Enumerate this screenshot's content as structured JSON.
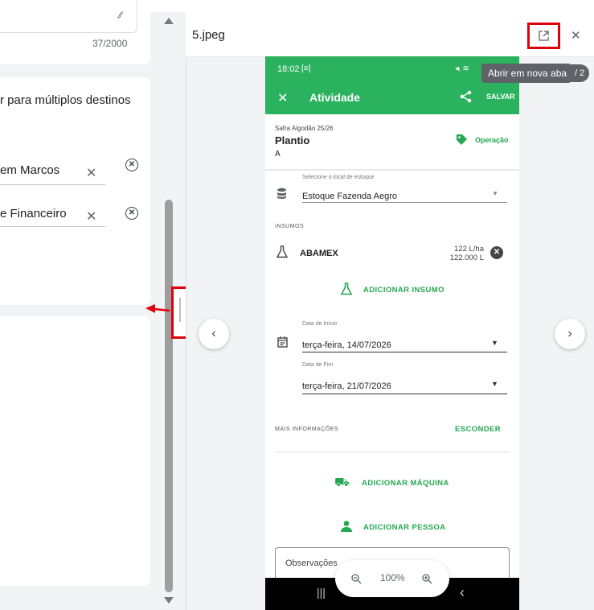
{
  "left_panel": {
    "counter": "37/2000",
    "multi_dest_text": "r para múltiplos destinos",
    "recipients": [
      {
        "name": "em Marcos"
      },
      {
        "name": "e Financeiro"
      }
    ]
  },
  "viewer": {
    "file_name": "5.jpeg",
    "tooltip": "Abrir em nova aba",
    "page_count": "/ 2",
    "zoom_level": "100%"
  },
  "phone": {
    "status_time": "18:02",
    "title": "Atividade",
    "save": "SALVAR",
    "safra": "Safra Algodão 25/26",
    "activity": "Plantio",
    "activity_sub": "A",
    "tag": "Operação",
    "stock_label": "Selecione o local de estoque",
    "stock_value": "Estoque Fazenda Aegro",
    "insumos_header": "INSUMOS",
    "insumo_name": "ABAMEX",
    "insumo_rate": "122 L/ha",
    "insumo_total": "122.000 L",
    "add_insumo": "ADICIONAR INSUMO",
    "start_label": "Data de Início",
    "start_value": "terça-feira, 14/07/2026",
    "end_label": "Data de Fim",
    "end_value": "terça-feira, 21/07/2026",
    "more_info": "MAIS INFORMAÇÕES",
    "hide": "ESCONDER",
    "add_machine": "ADICIONAR MÁQUINA",
    "add_person": "ADICIONAR PESSOA",
    "observations": "Observações"
  },
  "colors": {
    "accent_green": "#2bb25f",
    "annotation_red": "#e0000b"
  }
}
